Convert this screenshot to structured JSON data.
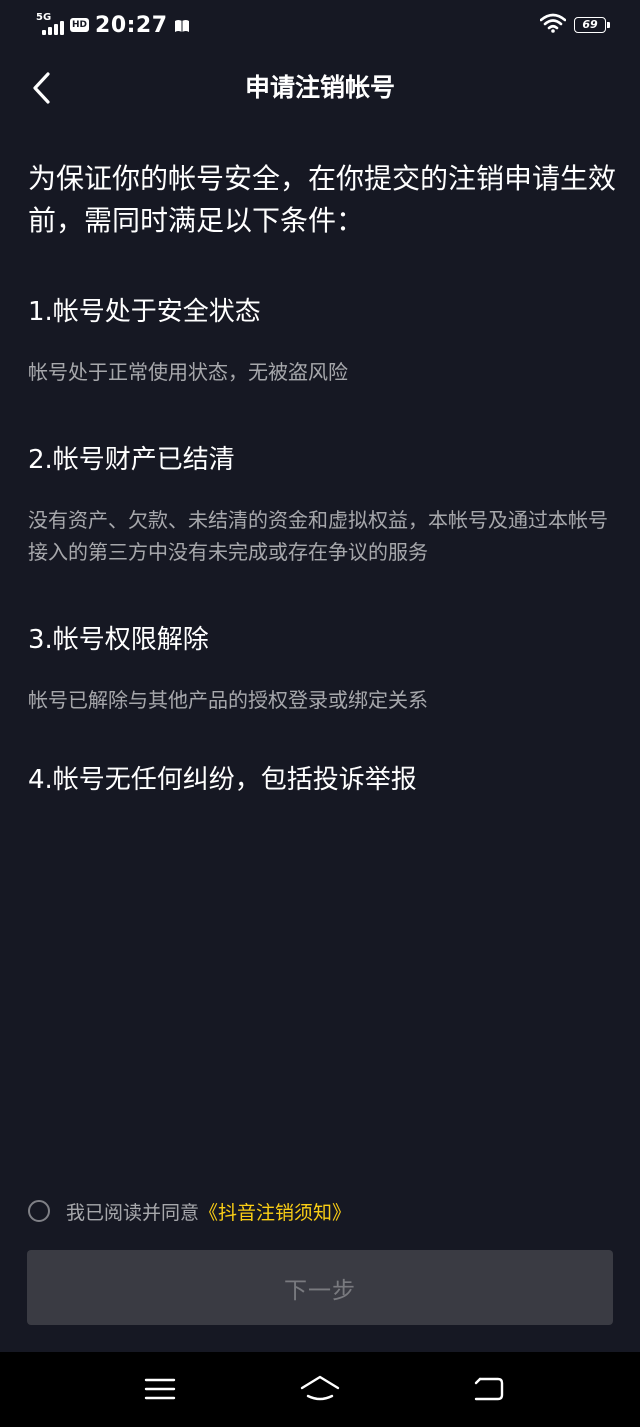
{
  "status_bar": {
    "network": "5G",
    "hd_badge": "HD",
    "time": "20:27",
    "battery": "69"
  },
  "header": {
    "title": "申请注销帐号",
    "back_icon": "chevron-left-icon"
  },
  "intro": "为保证你的帐号安全，在你提交的注销申请生效前，需同时满足以下条件：",
  "conditions": [
    {
      "title": "1.帐号处于安全状态",
      "description": "帐号处于正常使用状态，无被盗风险"
    },
    {
      "title": "2.帐号财产已结清",
      "description": "没有资产、欠款、未结清的资金和虚拟权益，本帐号及通过本帐号接入的第三方中没有未完成或存在争议的服务"
    },
    {
      "title": "3.帐号权限解除",
      "description": "帐号已解除与其他产品的授权登录或绑定关系"
    },
    {
      "title": "4.帐号无任何纠纷，包括投诉举报",
      "description": ""
    }
  ],
  "agreement": {
    "checked": false,
    "text": "我已阅读并同意",
    "link": "《抖音注销须知》"
  },
  "next_button": {
    "label": "下一步",
    "enabled": false
  },
  "colors": {
    "background": "#161823",
    "link": "#face15",
    "button_disabled": "#3a3b43"
  }
}
